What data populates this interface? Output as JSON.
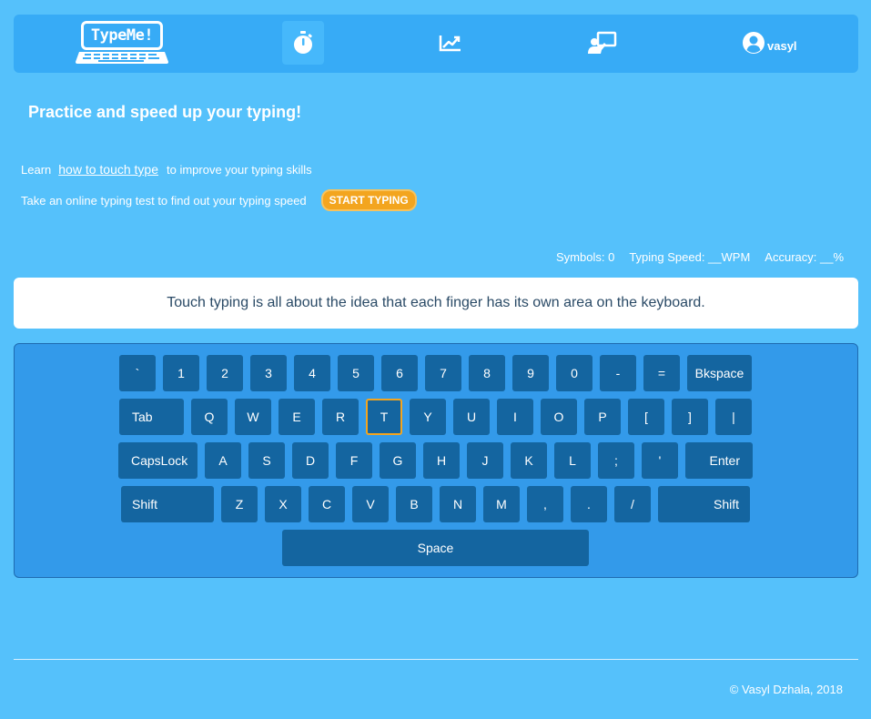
{
  "header": {
    "logo_text": "TypeMe!",
    "nav": {
      "timer_label": "typing test",
      "stats_label": "statistics",
      "teacher_label": "lessons",
      "user_name": "vasyl"
    }
  },
  "intro": {
    "headline": "Practice and speed up your typing!",
    "learn_prefix": "Learn",
    "learn_link": "how to touch type",
    "learn_suffix": "to improve your typing skills",
    "test_text": "Take an online typing test to find out your typing speed",
    "start_button": "START TYPING"
  },
  "stats": {
    "symbols": "Symbols: 0",
    "speed": "Typing Speed: __WPM",
    "accuracy": "Accuracy: __%"
  },
  "practice_text": "Touch typing is all about the idea that each finger has its own area on the keyboard.",
  "keyboard": {
    "active_key": "T",
    "rows": [
      [
        {
          "label": "`"
        },
        {
          "label": "1"
        },
        {
          "label": "2"
        },
        {
          "label": "3"
        },
        {
          "label": "4"
        },
        {
          "label": "5"
        },
        {
          "label": "6"
        },
        {
          "label": "7"
        },
        {
          "label": "8"
        },
        {
          "label": "9"
        },
        {
          "label": "0"
        },
        {
          "label": "-"
        },
        {
          "label": "="
        },
        {
          "label": "Bkspace"
        }
      ],
      [
        {
          "label": "Tab"
        },
        {
          "label": "Q"
        },
        {
          "label": "W"
        },
        {
          "label": "E"
        },
        {
          "label": "R"
        },
        {
          "label": "T"
        },
        {
          "label": "Y"
        },
        {
          "label": "U"
        },
        {
          "label": "I"
        },
        {
          "label": "O"
        },
        {
          "label": "P"
        },
        {
          "label": "["
        },
        {
          "label": "]"
        },
        {
          "label": "|"
        }
      ],
      [
        {
          "label": "CapsLock"
        },
        {
          "label": "A"
        },
        {
          "label": "S"
        },
        {
          "label": "D"
        },
        {
          "label": "F"
        },
        {
          "label": "G"
        },
        {
          "label": "H"
        },
        {
          "label": "J"
        },
        {
          "label": "K"
        },
        {
          "label": "L"
        },
        {
          "label": ";"
        },
        {
          "label": "'"
        },
        {
          "label": "Enter"
        }
      ],
      [
        {
          "label": "Shift"
        },
        {
          "label": "Z"
        },
        {
          "label": "X"
        },
        {
          "label": "C"
        },
        {
          "label": "V"
        },
        {
          "label": "B"
        },
        {
          "label": "N"
        },
        {
          "label": "M"
        },
        {
          "label": ","
        },
        {
          "label": "."
        },
        {
          "label": "/"
        },
        {
          "label": "Shift"
        }
      ],
      [
        {
          "label": "Space"
        }
      ]
    ]
  },
  "footer": {
    "copyright": "© Vasyl Dzhala, 2018"
  },
  "colors": {
    "background": "#55c1fb",
    "header": "#37abf6",
    "keyboard": "#339aea",
    "key": "#1465a0",
    "accent": "#f3a51f"
  }
}
